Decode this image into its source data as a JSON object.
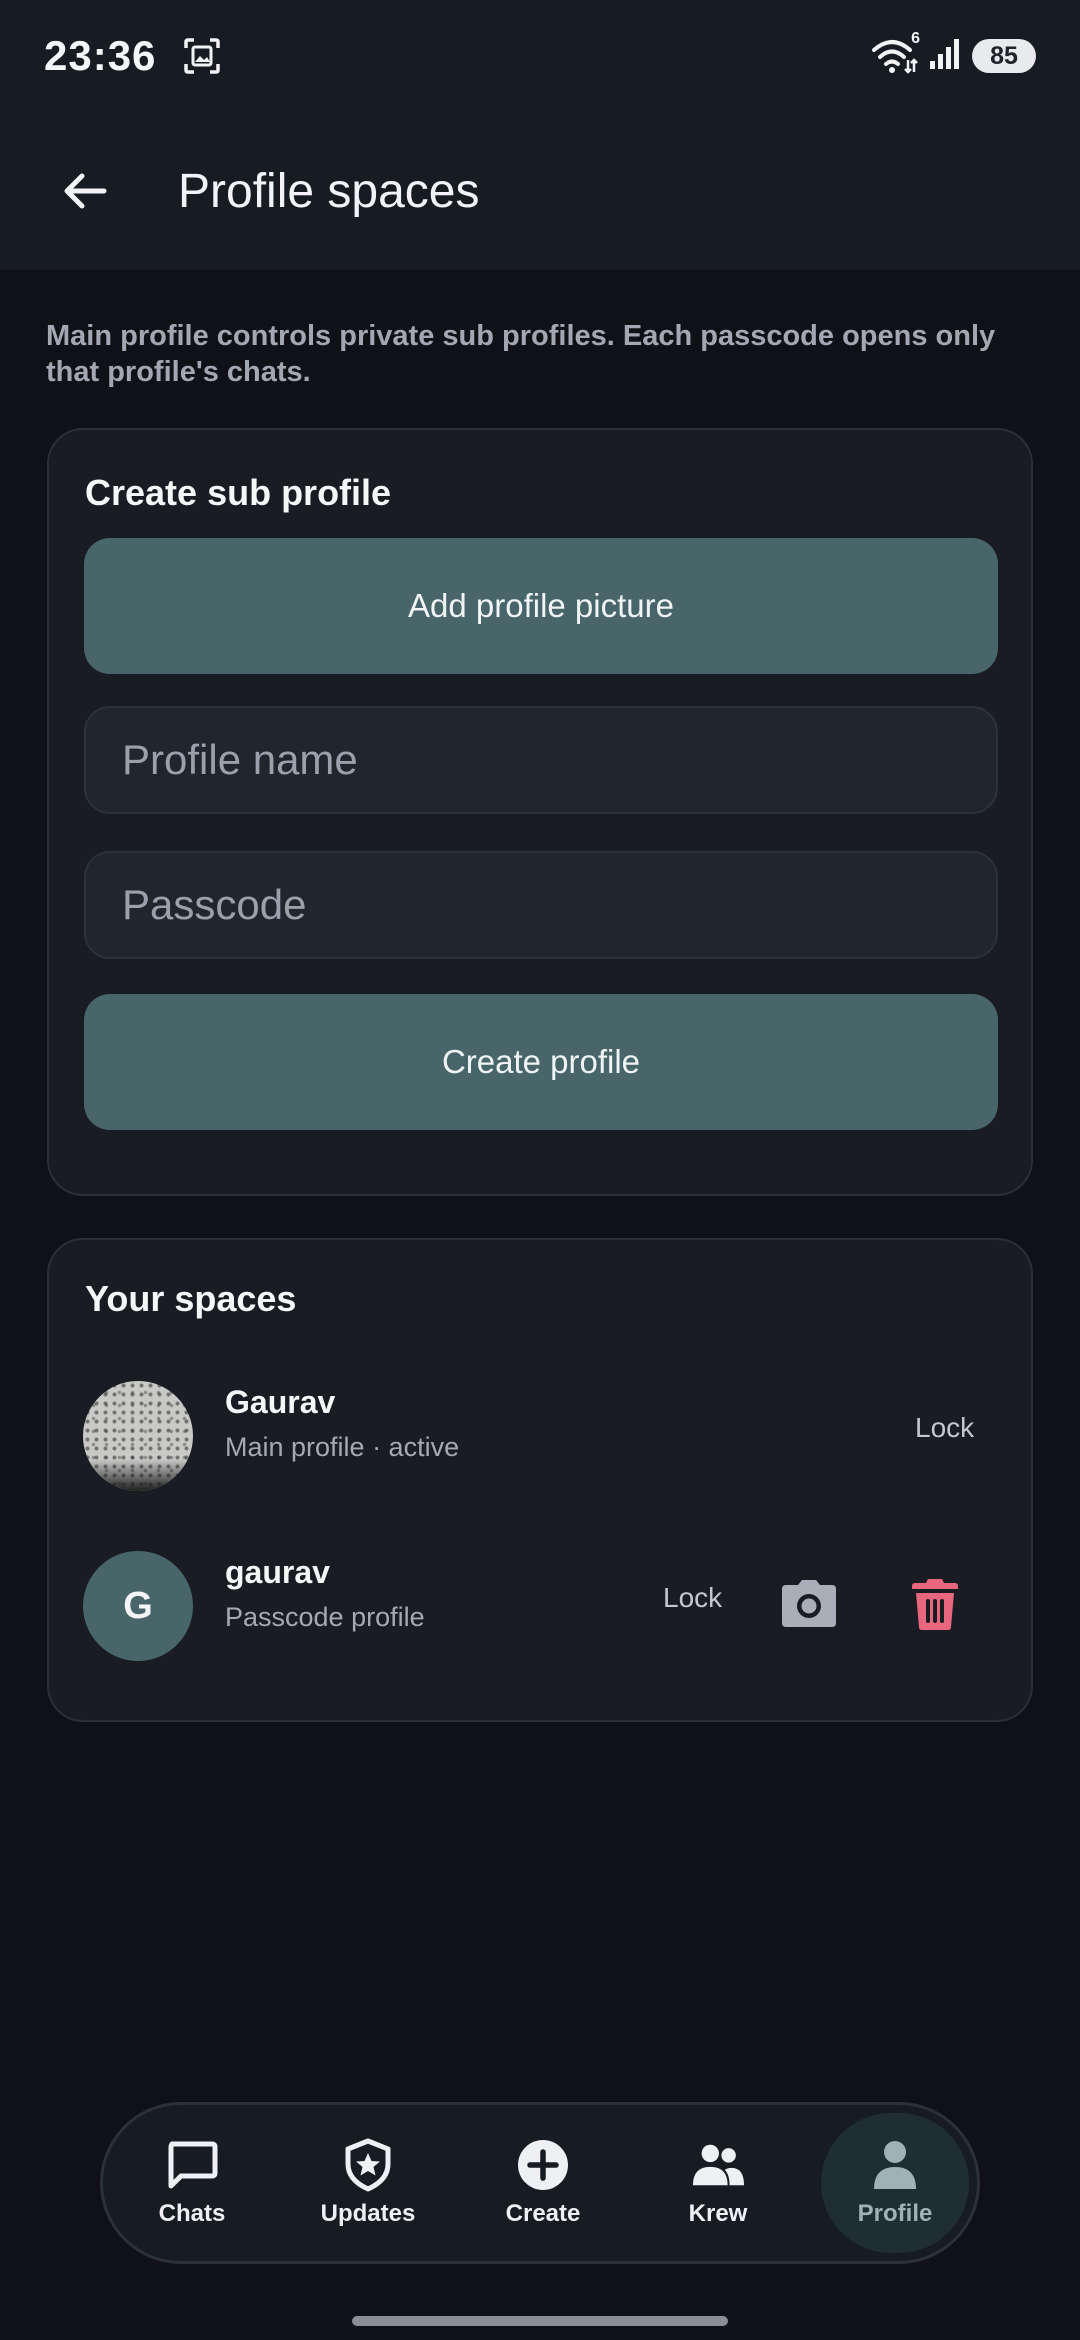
{
  "status_bar": {
    "time": "23:36",
    "battery": "85",
    "wifi_badge": "6",
    "icons": [
      "screenshot-icon",
      "wifi-icon",
      "signal-icon",
      "battery-icon"
    ]
  },
  "app_bar": {
    "title": "Profile spaces",
    "back_icon": "arrow-left-icon"
  },
  "description": "Main profile controls private sub profiles. Each passcode opens only that profile's chats.",
  "create_card": {
    "heading": "Create sub profile",
    "add_picture_label": "Add profile picture",
    "name_placeholder": "Profile name",
    "name_value": "",
    "passcode_placeholder": "Passcode",
    "passcode_value": "",
    "create_label": "Create profile"
  },
  "spaces_card": {
    "heading": "Your spaces",
    "items": [
      {
        "name": "Gaurav",
        "subtitle": "Main profile · active",
        "lock_label": "Lock",
        "avatar": "photo"
      },
      {
        "name": "gaurav",
        "subtitle": "Passcode profile",
        "lock_label": "Lock",
        "avatar_letter": "G",
        "actions": [
          "camera-icon",
          "trash-icon"
        ]
      }
    ]
  },
  "bottom_nav": {
    "items": [
      {
        "label": "Chats",
        "icon": "chat-icon"
      },
      {
        "label": "Updates",
        "icon": "shield-star-icon"
      },
      {
        "label": "Create",
        "icon": "plus-circle-icon"
      },
      {
        "label": "Krew",
        "icon": "people-icon"
      },
      {
        "label": "Profile",
        "icon": "person-icon",
        "active": true
      }
    ]
  },
  "colors": {
    "background": "#101116",
    "surface": "#191c22",
    "accent_teal": "#48666a",
    "danger": "#e8677f"
  }
}
